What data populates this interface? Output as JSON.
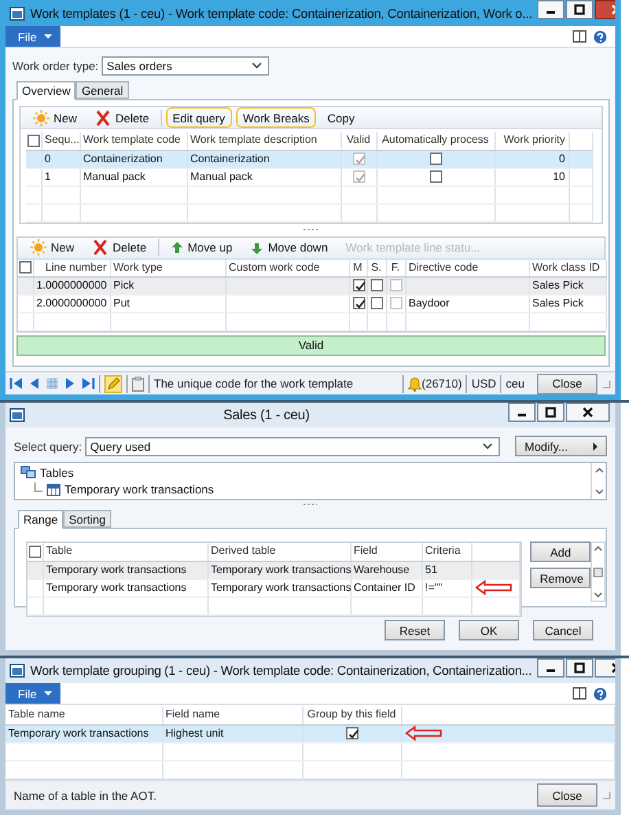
{
  "templates_window": {
    "title": "Work templates (1 - ceu) - Work template code: Containerization, Containerization, Work o...",
    "file_menu": "File",
    "order_type": {
      "label": "Work order type:",
      "value": "Sales orders"
    },
    "tabs": [
      {
        "label": "Overview",
        "selected": true
      },
      {
        "label": "General",
        "selected": false
      }
    ],
    "toolbar": [
      {
        "kind": "new",
        "label": "New",
        "highlighted": false
      },
      {
        "kind": "delete",
        "label": "Delete",
        "highlighted": false
      },
      {
        "kind": "text",
        "label": "Edit query",
        "highlighted": true
      },
      {
        "kind": "text",
        "label": "Work Breaks",
        "highlighted": true
      },
      {
        "kind": "text",
        "label": "Copy",
        "highlighted": false
      }
    ],
    "grid": {
      "focused": true,
      "select_all": {
        "checked": false
      },
      "columns": [
        {
          "label": "Sequ...",
          "kind": "text"
        },
        {
          "label": "Work template code",
          "kind": "text"
        },
        {
          "label": "Work template description",
          "kind": "text"
        },
        {
          "label": "Valid",
          "kind": "check",
          "disabled": true
        },
        {
          "label": "Automatically process",
          "kind": "check",
          "disabled": false
        },
        {
          "label": "Work priority",
          "kind": "number"
        }
      ],
      "rows": [
        {
          "selected": true,
          "sequence": "0",
          "code": "Containerization",
          "description": "Containerization",
          "valid": true,
          "auto_process": false,
          "priority": "0"
        },
        {
          "selected": false,
          "sequence": "1",
          "code": "Manual pack",
          "description": "Manual pack",
          "valid": true,
          "auto_process": false,
          "priority": "10"
        }
      ]
    },
    "lines_toolbar": [
      {
        "kind": "new",
        "label": "New",
        "disabled": false
      },
      {
        "kind": "delete",
        "label": "Delete",
        "disabled": false
      },
      {
        "kind": "up",
        "label": "Move up",
        "disabled": false
      },
      {
        "kind": "down",
        "label": "Move down",
        "disabled": false
      },
      {
        "kind": "text",
        "label": "Work template line statu...",
        "disabled": true
      }
    ],
    "lines_grid": {
      "focused": false,
      "select_all": {
        "checked": false
      },
      "columns": [
        {
          "label": "Line number",
          "kind": "number"
        },
        {
          "label": "Work type",
          "kind": "text"
        },
        {
          "label": "Custom work code",
          "kind": "text"
        },
        {
          "label": "M",
          "kind": "check",
          "disabled": false
        },
        {
          "label": "S.",
          "kind": "check",
          "disabled": false
        },
        {
          "label": "F.",
          "kind": "check",
          "disabled": true
        },
        {
          "label": "Directive code",
          "kind": "text"
        },
        {
          "label": "Work class ID",
          "kind": "text"
        }
      ],
      "rows": [
        {
          "selected": true,
          "line_number": "1.0000000000",
          "work_type": "Pick",
          "m": true,
          "s": false,
          "f": false,
          "work_class_id": "Sales Pick"
        },
        {
          "selected": false,
          "line_number": "2.0000000000",
          "work_type": "Put",
          "m": true,
          "s": false,
          "f": false,
          "directive_code": "Baydoor",
          "work_class_id": "Sales Pick"
        }
      ]
    },
    "validation": "Valid",
    "status_bar": {
      "help_text": "The unique code for the work template",
      "notifications": "(26710)",
      "currency": "USD",
      "company": "ceu",
      "close_button": "Close"
    }
  },
  "query_window": {
    "title": "Sales (1 - ceu)",
    "select_query": {
      "label": "Select query:",
      "value": "Query used"
    },
    "modify_button": "Modify...",
    "tree": [
      {
        "label": "Tables",
        "children": [
          {
            "label": "Temporary work transactions"
          }
        ]
      }
    ],
    "tabs": [
      {
        "label": "Range",
        "selected": true
      },
      {
        "label": "Sorting",
        "selected": false
      }
    ],
    "range_grid": {
      "focused": false,
      "select_all": {
        "checked": false
      },
      "columns": [
        {
          "label": "Table",
          "kind": "text"
        },
        {
          "label": "Derived table",
          "kind": "text"
        },
        {
          "label": "Field",
          "kind": "text"
        },
        {
          "label": "Criteria",
          "kind": "text"
        }
      ],
      "rows": [
        {
          "selected": true,
          "marked": false,
          "table": "Temporary work transactions",
          "derived_table": "Temporary work transactions",
          "field": "Warehouse",
          "criteria": "51"
        },
        {
          "selected": false,
          "marked": true,
          "table": "Temporary work transactions",
          "derived_table": "Temporary work transactions",
          "field": "Container ID",
          "criteria": "!=\"\""
        }
      ]
    },
    "side_buttons": [
      "Add",
      "Remove"
    ],
    "footer_buttons": [
      "Reset",
      "OK",
      "Cancel"
    ]
  },
  "grouping_window": {
    "title": "Work template grouping (1 - ceu) - Work template code: Containerization, Containerization...",
    "file_menu": "File",
    "grid": {
      "focused": true,
      "columns": [
        {
          "label": "Table name",
          "kind": "text"
        },
        {
          "label": "Field name",
          "kind": "text"
        },
        {
          "label": "Group by this field",
          "kind": "check",
          "disabled": false
        }
      ],
      "rows": [
        {
          "selected": true,
          "marked": true,
          "table_name": "Temporary work transactions",
          "field_name": "Highest unit",
          "group_by": true
        }
      ]
    },
    "status_bar": {
      "help_text": "Name of a table in the AOT.",
      "close_button": "Close"
    }
  }
}
